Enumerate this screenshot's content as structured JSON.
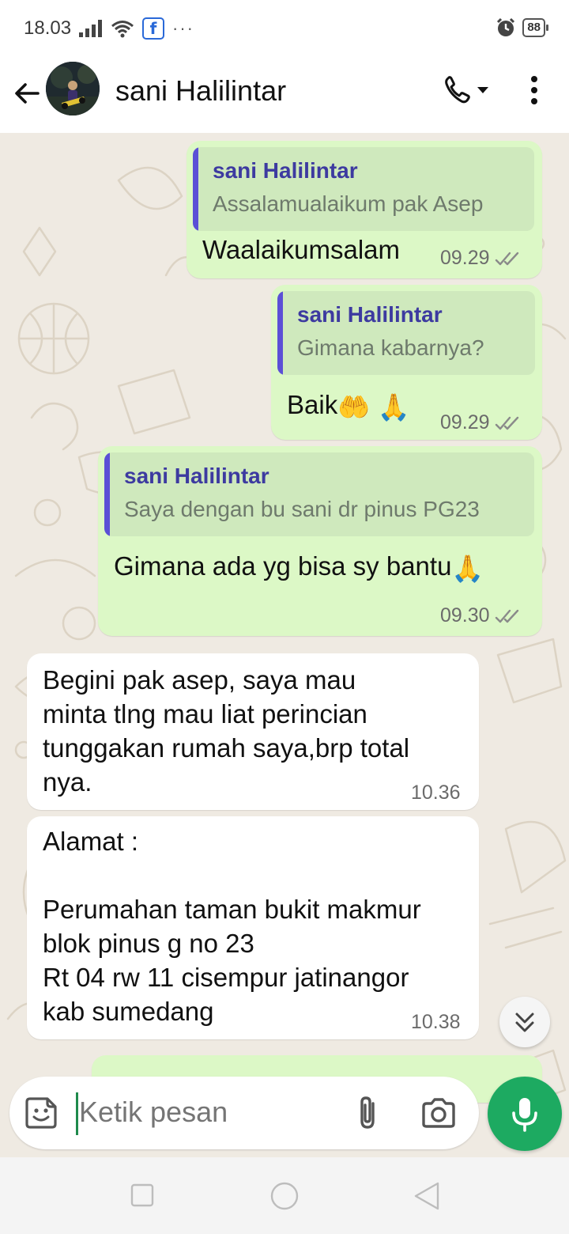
{
  "status_bar": {
    "time": "18.03",
    "battery": "88",
    "more": "···",
    "fb_glyph": "f"
  },
  "header": {
    "contact_name": "sani Halilintar",
    "back_icon": "arrow-left-icon",
    "call_icon": "phone-icon",
    "menu_icon": "more-vertical-icon"
  },
  "messages": [
    {
      "direction": "out",
      "quote_name": "sani Halilintar",
      "quote_text": "Assalamualaikum pak Asep",
      "text": "Waalaikumsalam",
      "time": "09.29",
      "status": "read"
    },
    {
      "direction": "out",
      "quote_name": "sani Halilintar",
      "quote_text": "Gimana kabarnya?",
      "text": "Baik",
      "emoji": [
        "🤲",
        "🙏"
      ],
      "time": "09.29",
      "status": "read"
    },
    {
      "direction": "out",
      "quote_name": "sani Halilintar",
      "quote_text": "Saya dengan bu sani dr pinus PG23",
      "text": "Gimana ada yg bisa sy bantu",
      "emoji": [
        "🙏"
      ],
      "time": "09.30",
      "status": "read"
    },
    {
      "direction": "in",
      "text": "Begini pak asep, saya mau\nminta tlng mau liat perincian\ntunggakan rumah saya,brp total\nnya.",
      "time": "10.36"
    },
    {
      "direction": "in",
      "text": "Alamat :\n\nPerumahan taman bukit makmur\nblok pinus g no 23\nRt 04 rw 11 cisempur jatinangor\nkab sumedang",
      "time": "10.38"
    }
  ],
  "input": {
    "placeholder": "Ketik pesan"
  },
  "colors": {
    "outgoing_bubble": "#dcf8c6",
    "incoming_bubble": "#ffffff",
    "quote_accent": "#5b4fd6",
    "quote_name": "#3d3aa0",
    "mic_button": "#1daa61",
    "read_tick": "#8a8a8a",
    "wallpaper": "#efeae2"
  }
}
